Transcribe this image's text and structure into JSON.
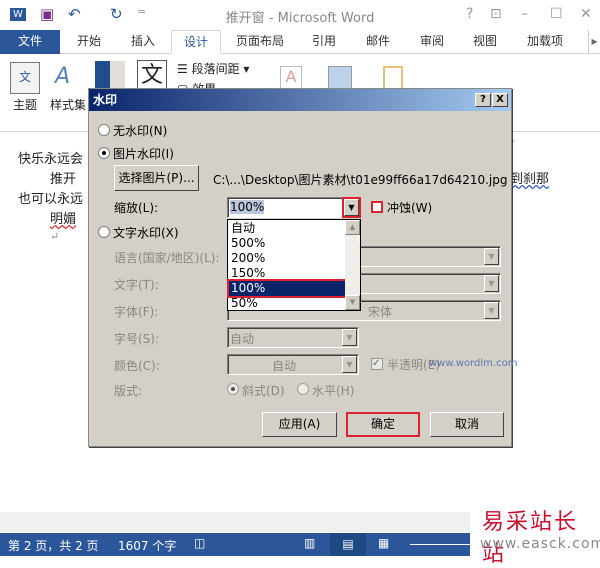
{
  "window": {
    "title": "推开窗 - Microsoft Word",
    "help": "?",
    "restore": "⊡",
    "minimize": "–",
    "maximize": "☐",
    "close": "✕"
  },
  "quick_access": {
    "word": "W",
    "save": "💾",
    "undo": "↶",
    "redo": "↻",
    "customize": "="
  },
  "tabs": [
    "文件",
    "开始",
    "插入",
    "设计",
    "页面布局",
    "引用",
    "邮件",
    "审阅",
    "视图",
    "加载项"
  ],
  "ribbon": {
    "theme": "主题",
    "styleset": "样式集",
    "paragraph_spacing": "段落间距",
    "effects": "效果",
    "wen": "文"
  },
  "document": {
    "lines": [
      "快乐永远会",
      "推开",
      "到刹那",
      "也可以永远",
      "明媚",
      "↵"
    ]
  },
  "dialog": {
    "title": "水印",
    "help": "?",
    "close": "X",
    "no_watermark": "无水印(N)",
    "picture_watermark": "图片水印(I)",
    "select_picture": "选择图片(P)...",
    "picture_path": "C:\\...\\Desktop\\图片素材\\t01e99ff66a17d64210.jpg",
    "scale_label": "缩放(L):",
    "scale_value": "100%",
    "scale_options": [
      "自动",
      "500%",
      "200%",
      "150%",
      "100%",
      "50%"
    ],
    "washout": "冲蚀(W)",
    "text_watermark": "文字水印(X)",
    "language_label": "语言(国家/地区)(L):",
    "text_label": "文字(T):",
    "font_label": "字体(F):",
    "font_value": "宋体",
    "size_label": "字号(S):",
    "size_value": "自动",
    "color_label": "颜色(C):",
    "color_value": "自动",
    "semitransparent": "半透明(E)",
    "layout_label": "版式:",
    "diagonal": "斜式(D)",
    "horizontal": "水平(H)",
    "apply": "应用(A)",
    "ok": "确定",
    "cancel": "取消"
  },
  "status": {
    "page": "第 2 页，共 2 页",
    "words": "1607 个字"
  },
  "watermark": {
    "site_cn": "易采站长站",
    "site_url": "www.easck.com",
    "dialog_site": "www.wordlm.com"
  }
}
